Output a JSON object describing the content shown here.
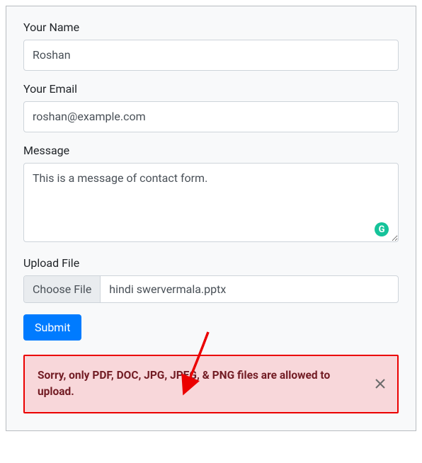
{
  "form": {
    "name": {
      "label": "Your Name",
      "value": "Roshan"
    },
    "email": {
      "label": "Your Email",
      "value": "roshan@example.com"
    },
    "message": {
      "label": "Message",
      "value": "This is a message of contact form."
    },
    "file": {
      "label": "Upload File",
      "button_label": "Choose File",
      "filename": "hindi swervermala.pptx"
    },
    "submit_label": "Submit"
  },
  "alert": {
    "message": "Sorry, only PDF, DOC, JPG, JPEG, & PNG files are allowed to upload."
  },
  "icons": {
    "grammarly": "G"
  }
}
